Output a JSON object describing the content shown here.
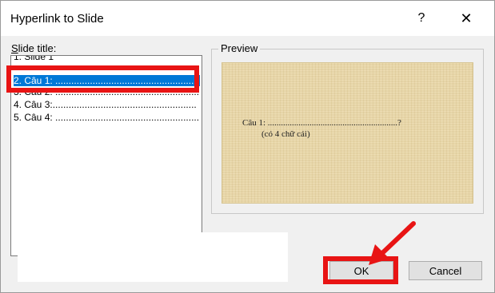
{
  "dialog": {
    "title": "Hyperlink to Slide",
    "help_glyph": "?",
    "close_glyph": "✕"
  },
  "slide_list": {
    "label_access_key": "S",
    "label_rest": "lide title:",
    "items": [
      {
        "label": "1. Slide 1"
      },
      {
        "label": "2. Câu 1: ......................................................"
      },
      {
        "label": "3. Câu 2: ......................................................"
      },
      {
        "label": "4. Câu 3:......................................................"
      },
      {
        "label": "5. Câu 4: ......................................................"
      }
    ],
    "selected_index": 1
  },
  "preview": {
    "label": "Preview",
    "line1": "Câu 1: ...........................................................?",
    "line2": "(có 4 chữ cái)"
  },
  "buttons": {
    "ok": "OK",
    "cancel": "Cancel"
  },
  "annotation": {
    "color": "#e81414"
  }
}
